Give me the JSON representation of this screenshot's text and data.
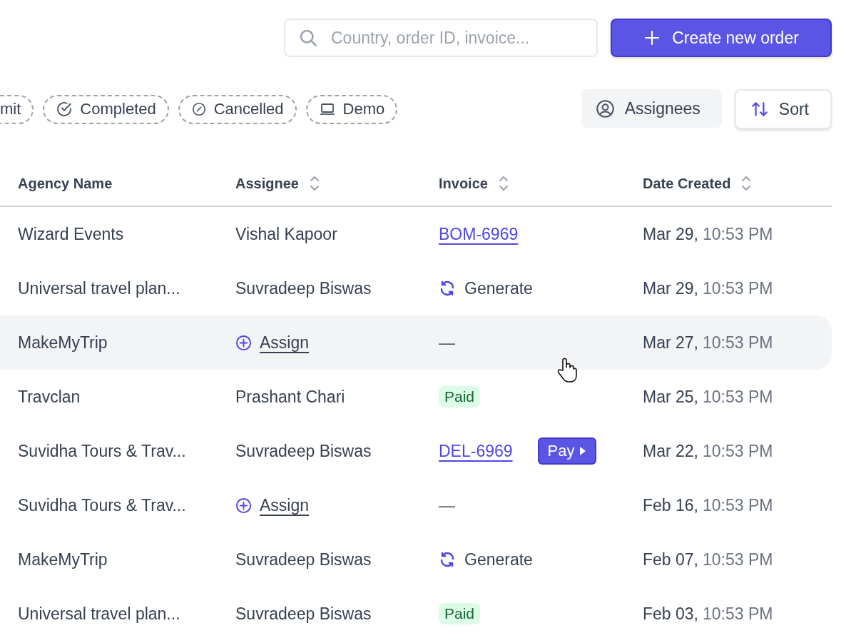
{
  "search": {
    "placeholder": "Country, order ID, invoice..."
  },
  "create_button": {
    "label": "Create new order"
  },
  "filters": [
    {
      "label": "mit",
      "kind": "cut"
    },
    {
      "label": "Completed",
      "kind": "check"
    },
    {
      "label": "Cancelled",
      "kind": "cancel"
    },
    {
      "label": "Demo",
      "kind": "laptop"
    }
  ],
  "assignees_button": {
    "label": "Assignees"
  },
  "sort_button": {
    "label": "Sort"
  },
  "table": {
    "columns": [
      {
        "label": "Agency Name",
        "sortable": false
      },
      {
        "label": "Assignee",
        "sortable": true
      },
      {
        "label": "Invoice",
        "sortable": true
      },
      {
        "label": "Date Created",
        "sortable": true
      }
    ],
    "rows": [
      {
        "agency": "Wizard Events",
        "assignee": {
          "kind": "name",
          "text": "Vishal Kapoor"
        },
        "invoice": {
          "kind": "link",
          "text": "BOM-6969"
        },
        "date": "Mar 29,",
        "time": "10:53 PM",
        "selected": false
      },
      {
        "agency": "Universal travel plan...",
        "assignee": {
          "kind": "name",
          "text": "Suvradeep Biswas"
        },
        "invoice": {
          "kind": "generate",
          "text": "Generate"
        },
        "date": "Mar 29,",
        "time": "10:53 PM",
        "selected": false
      },
      {
        "agency": "MakeMyTrip",
        "assignee": {
          "kind": "assign",
          "text": "Assign"
        },
        "invoice": {
          "kind": "none",
          "text": "—"
        },
        "date": "Mar 27,",
        "time": "10:53 PM",
        "selected": true
      },
      {
        "agency": "Travclan",
        "assignee": {
          "kind": "name",
          "text": "Prashant Chari"
        },
        "invoice": {
          "kind": "paid",
          "text": "Paid"
        },
        "date": "Mar 25,",
        "time": "10:53 PM",
        "selected": false
      },
      {
        "agency": "Suvidha Tours & Trav...",
        "assignee": {
          "kind": "name",
          "text": "Suvradeep Biswas"
        },
        "invoice": {
          "kind": "link",
          "text": "DEL-6969",
          "pay": "Pay"
        },
        "date": "Mar 22,",
        "time": "10:53 PM",
        "selected": false
      },
      {
        "agency": "Suvidha Tours & Trav...",
        "assignee": {
          "kind": "assign",
          "text": "Assign"
        },
        "invoice": {
          "kind": "none",
          "text": "—"
        },
        "date": "Feb 16,",
        "time": "10:53 PM",
        "selected": false
      },
      {
        "agency": "MakeMyTrip",
        "assignee": {
          "kind": "name",
          "text": "Suvradeep Biswas"
        },
        "invoice": {
          "kind": "generate",
          "text": "Generate"
        },
        "date": "Feb 07,",
        "time": "10:53 PM",
        "selected": false
      },
      {
        "agency": "Universal travel plan...",
        "assignee": {
          "kind": "name",
          "text": "Suvradeep Biswas"
        },
        "invoice": {
          "kind": "paid",
          "text": "Paid"
        },
        "date": "Feb 03,",
        "time": "10:53 PM",
        "selected": false
      }
    ]
  }
}
